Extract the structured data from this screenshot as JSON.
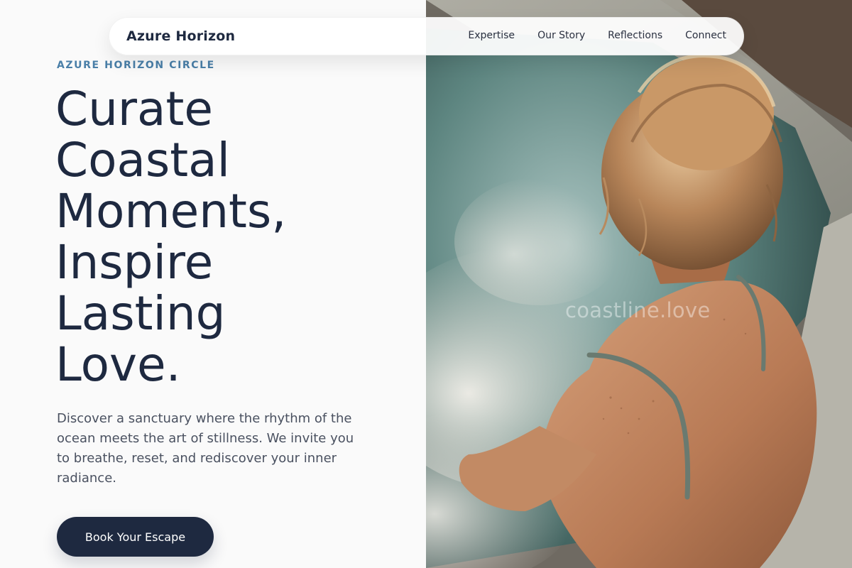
{
  "nav": {
    "brand": "Azure Horizon",
    "links": [
      "Expertise",
      "Our Story",
      "Reflections",
      "Connect"
    ]
  },
  "hero": {
    "eyebrow": "AZURE HORIZON CIRCLE",
    "headline_lines": [
      "Curate",
      "Coastal",
      "Moments,",
      "Inspire",
      "Lasting",
      "Love."
    ],
    "body": "Discover a sanctuary where the rhythm of the ocean meets the art of stillness. We invite you to breathe, reset, and rediscover your inner radiance.",
    "cta_label": "Book Your Escape"
  },
  "photo": {
    "watermark": "coastline.love"
  },
  "colors": {
    "accent": "#4a7fa8",
    "navy": "#1e2940",
    "background": "#fafafa"
  }
}
